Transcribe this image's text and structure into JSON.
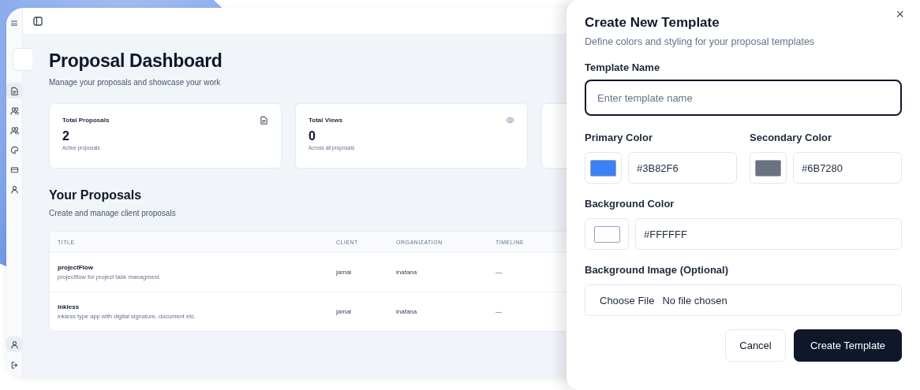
{
  "sidebar": {
    "items": [
      {
        "selected": true
      },
      {
        "selected": false
      },
      {
        "selected": false
      },
      {
        "selected": false
      },
      {
        "selected": false
      },
      {
        "selected": false
      }
    ],
    "bottom_items": [
      {
        "selected": true
      },
      {
        "selected": false
      }
    ]
  },
  "dashboard": {
    "title": "Proposal Dashboard",
    "subtitle": "Manage your proposals and showcase your work",
    "stats": [
      {
        "label": "Total Proposals",
        "value": "2",
        "caption": "Active proposals",
        "kind": "document"
      },
      {
        "label": "Total Views",
        "value": "0",
        "caption": "Across all proposals",
        "kind": "views"
      },
      {
        "kind": "blank"
      }
    ],
    "section_title": "Your Proposals",
    "section_subtitle": "Create and manage client proposals",
    "table": {
      "columns": [
        "TITLE",
        "CLIENT",
        "ORGANIZATION",
        "TIMELINE"
      ],
      "rows": [
        {
          "title": "projectFlow",
          "description": "projectflow for project task managment.",
          "client": "jamal",
          "organization": "inafana",
          "timeline": "—"
        },
        {
          "title": "inkless",
          "description": "inkless type app with digital signature, document etc.",
          "client": "jamal",
          "organization": "inafana",
          "timeline": "—"
        }
      ]
    }
  },
  "modal": {
    "title": "Create New Template",
    "subtitle": "Define colors and styling for your proposal templates",
    "close": "×",
    "name_field": {
      "label": "Template Name",
      "placeholder": "Enter template name"
    },
    "colors": [
      {
        "label": "Primary Color",
        "color": "#3b82f6",
        "value": "#3B82F6"
      },
      {
        "label": "Secondary Color",
        "color": "#6b7280",
        "value": "#6B7280"
      },
      {
        "label": "Background Color",
        "color": "#ffffff",
        "value": "#FFFFFF"
      }
    ],
    "image_field": {
      "label": "Background Image (Optional)",
      "button": "Choose File",
      "status": "No file chosen"
    },
    "buttons": [
      {
        "label": "Cancel",
        "kind": "secondary"
      },
      {
        "label": "Create Template",
        "kind": "primary"
      }
    ]
  }
}
